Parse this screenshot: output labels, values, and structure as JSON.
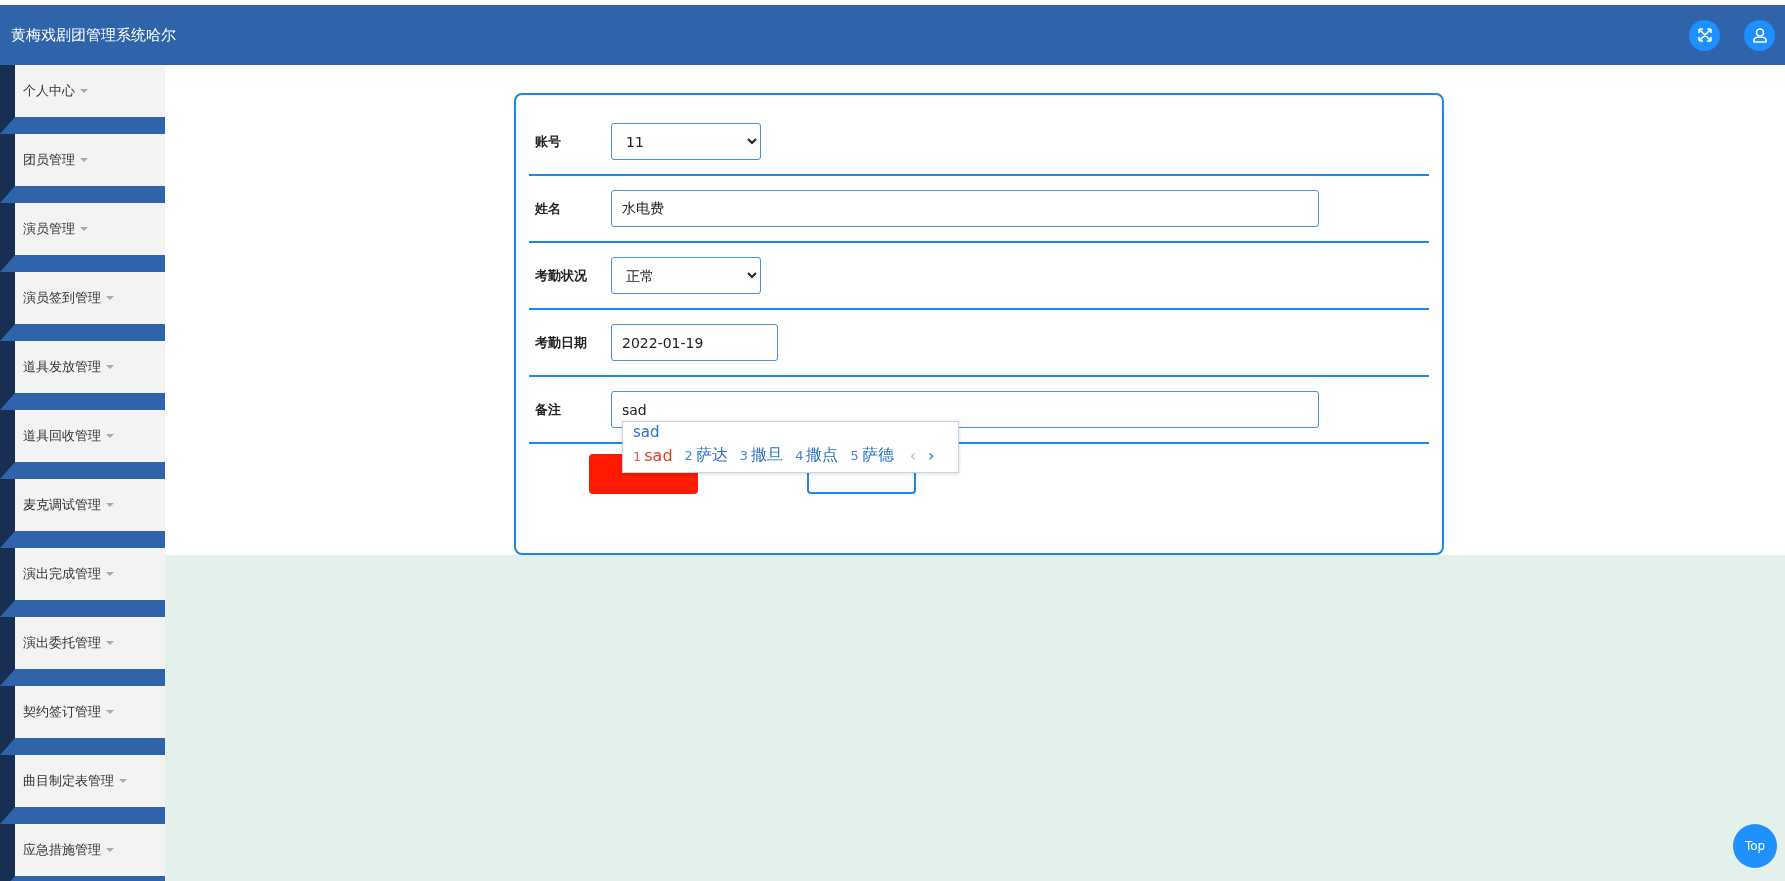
{
  "header": {
    "title": "黄梅戏剧团管理系统哈尔"
  },
  "sidebar": {
    "items": [
      {
        "label": "个人中心"
      },
      {
        "label": "团员管理"
      },
      {
        "label": "演员管理"
      },
      {
        "label": "演员签到管理"
      },
      {
        "label": "道具发放管理"
      },
      {
        "label": "道具回收管理"
      },
      {
        "label": "麦克调试管理"
      },
      {
        "label": "演出完成管理"
      },
      {
        "label": "演出委托管理"
      },
      {
        "label": "契约签订管理"
      },
      {
        "label": "曲目制定表管理"
      },
      {
        "label": "应急措施管理"
      }
    ]
  },
  "form": {
    "fields": [
      {
        "label": "账号",
        "kind": "select",
        "value": "11"
      },
      {
        "label": "姓名",
        "kind": "text",
        "value": "水电费"
      },
      {
        "label": "考勤状况",
        "kind": "select",
        "value": "正常"
      },
      {
        "label": "考勤日期",
        "kind": "date",
        "value": "2022-01-19"
      },
      {
        "label": "备注",
        "kind": "text",
        "value": "sad"
      }
    ],
    "buttons": [
      {
        "kind": "primary"
      },
      {
        "kind": "secondary"
      }
    ]
  },
  "ime": {
    "composition": "sad",
    "candidates": [
      {
        "number": "1",
        "text": "sad",
        "selected": true
      },
      {
        "number": "2",
        "text": "萨达",
        "selected": false
      },
      {
        "number": "3",
        "text": "撒旦",
        "selected": false
      },
      {
        "number": "4",
        "text": "撒点",
        "selected": false
      },
      {
        "number": "5",
        "text": "萨德",
        "selected": false
      }
    ],
    "prev": "‹",
    "next": "›"
  },
  "back_to_top": "Top"
}
